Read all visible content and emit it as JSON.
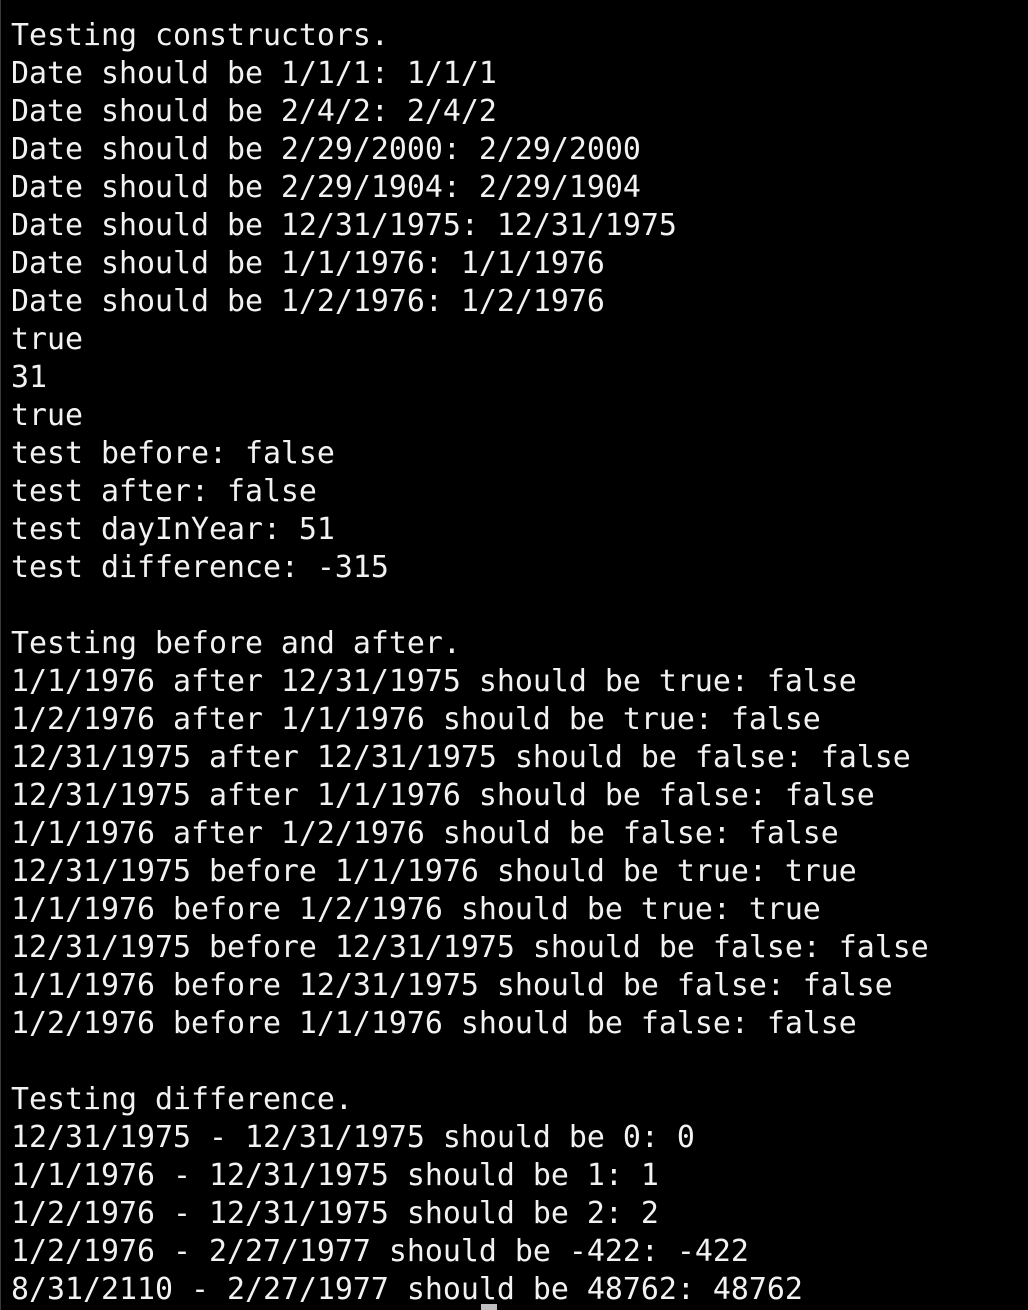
{
  "terminal": {
    "background": "#000000",
    "foreground": "#f2f2f2",
    "lines": [
      "Testing constructors.",
      "Date should be 1/1/1: 1/1/1",
      "Date should be 2/4/2: 2/4/2",
      "Date should be 2/29/2000: 2/29/2000",
      "Date should be 2/29/1904: 2/29/1904",
      "Date should be 12/31/1975: 12/31/1975",
      "Date should be 1/1/1976: 1/1/1976",
      "Date should be 1/2/1976: 1/2/1976",
      "true",
      "31",
      "true",
      "test before: false",
      "test after: false",
      "test dayInYear: 51",
      "test difference: -315",
      "",
      "Testing before and after.",
      "1/1/1976 after 12/31/1975 should be true: false",
      "1/2/1976 after 1/1/1976 should be true: false",
      "12/31/1975 after 12/31/1975 should be false: false",
      "12/31/1975 after 1/1/1976 should be false: false",
      "1/1/1976 after 1/2/1976 should be false: false",
      "12/31/1975 before 1/1/1976 should be true: true",
      "1/1/1976 before 1/2/1976 should be true: true",
      "12/31/1975 before 12/31/1975 should be false: false",
      "1/1/1976 before 12/31/1975 should be false: false",
      "1/2/1976 before 1/1/1976 should be false: false",
      "",
      "Testing difference.",
      "12/31/1975 - 12/31/1975 should be 0: 0",
      "1/1/1976 - 12/31/1975 should be 1: 1",
      "1/2/1976 - 12/31/1975 should be 2: 2",
      "1/2/1976 - 2/27/1977 should be -422: -422",
      "8/31/2110 - 2/27/1977 should be 48762: 48762"
    ]
  }
}
